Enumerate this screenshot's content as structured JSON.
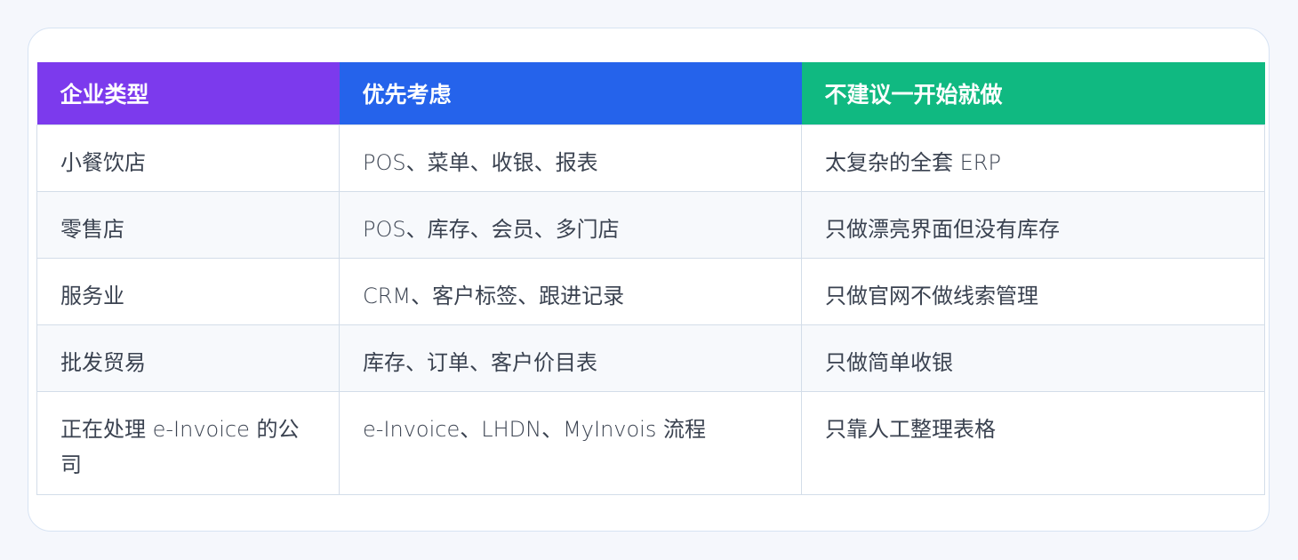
{
  "table": {
    "headers": [
      "企业类型",
      "优先考虑",
      "不建议一开始就做"
    ],
    "header_colors": [
      "#7c3aed",
      "#2563eb",
      "#10b981"
    ],
    "rows": [
      [
        "小餐饮店",
        "POS、菜单、收银、报表",
        "太复杂的全套 ERP"
      ],
      [
        "零售店",
        "POS、库存、会员、多门店",
        "只做漂亮界面但没有库存"
      ],
      [
        "服务业",
        "CRM、客户标签、跟进记录",
        "只做官网不做线索管理"
      ],
      [
        "批发贸易",
        "库存、订单、客户价目表",
        "只做简单收银"
      ],
      [
        "正在处理 e-Invoice 的公司",
        "e-Invoice、LHDN、MyInvois 流程",
        "只靠人工整理表格"
      ]
    ]
  }
}
